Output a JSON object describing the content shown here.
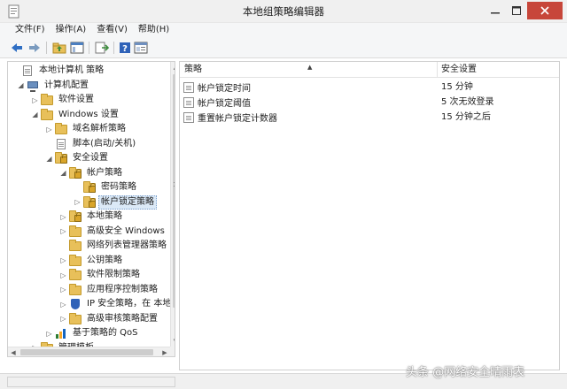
{
  "window": {
    "title": "本地组策略编辑器"
  },
  "menu": [
    {
      "label": "文件(F)"
    },
    {
      "label": "操作(A)"
    },
    {
      "label": "查看(V)"
    },
    {
      "label": "帮助(H)"
    }
  ],
  "toolbar": {
    "icons": [
      "back-icon",
      "forward-icon",
      "up-folder-icon",
      "show-hide-tree-icon",
      "export-list-icon",
      "help-icon",
      "properties-icon"
    ]
  },
  "tree": {
    "items": [
      {
        "label": "本地计算机 策略",
        "icon": "policy-doc-icon",
        "arrow": ""
      },
      {
        "label": "计算机配置",
        "icon": "computer-icon",
        "arrow": "◢"
      },
      {
        "label": "软件设置",
        "icon": "folder-icon",
        "arrow": "▷"
      },
      {
        "label": "Windows 设置",
        "icon": "folder-icon",
        "arrow": "◢"
      },
      {
        "label": "域名解析策略",
        "icon": "folder-icon",
        "arrow": "▷"
      },
      {
        "label": "脚本(启动/关机)",
        "icon": "script-icon",
        "arrow": ""
      },
      {
        "label": "安全设置",
        "icon": "security-folder-icon",
        "arrow": "◢"
      },
      {
        "label": "帐户策略",
        "icon": "folder-lock-icon",
        "arrow": "◢"
      },
      {
        "label": "密码策略",
        "icon": "folder-lock-icon",
        "arrow": ""
      },
      {
        "label": "帐户锁定策略",
        "icon": "folder-lock-icon",
        "arrow": "▷"
      },
      {
        "label": "本地策略",
        "icon": "folder-lock-icon",
        "arrow": "▷"
      },
      {
        "label": "高级安全 Windows",
        "icon": "folder-icon",
        "arrow": "▷"
      },
      {
        "label": "网络列表管理器策略",
        "icon": "folder-icon",
        "arrow": ""
      },
      {
        "label": "公钥策略",
        "icon": "folder-icon",
        "arrow": "▷"
      },
      {
        "label": "软件限制策略",
        "icon": "folder-icon",
        "arrow": "▷"
      },
      {
        "label": "应用程序控制策略",
        "icon": "folder-icon",
        "arrow": "▷"
      },
      {
        "label": "IP 安全策略，在 本地",
        "icon": "ipsec-shield-icon",
        "arrow": "▷"
      },
      {
        "label": "高级审核策略配置",
        "icon": "folder-icon",
        "arrow": "▷"
      },
      {
        "label": "基于策略的 QoS",
        "icon": "bar-chart-icon",
        "arrow": "▷"
      },
      {
        "label": "管理模板",
        "icon": "folder-icon",
        "arrow": "▷"
      }
    ]
  },
  "list": {
    "columns": [
      "策略",
      "安全设置"
    ],
    "rows": [
      {
        "name": "帐户锁定时间",
        "value": "15 分钟"
      },
      {
        "name": "帐户锁定阈值",
        "value": "5 次无效登录"
      },
      {
        "name": "重置帐户锁定计数器",
        "value": "15 分钟之后"
      }
    ]
  },
  "watermark": "头条 @网络安全晴雨表",
  "colors": {
    "close_button": "#c7463a",
    "selection": "#dbe9f7",
    "folder": "#e8c05a"
  }
}
